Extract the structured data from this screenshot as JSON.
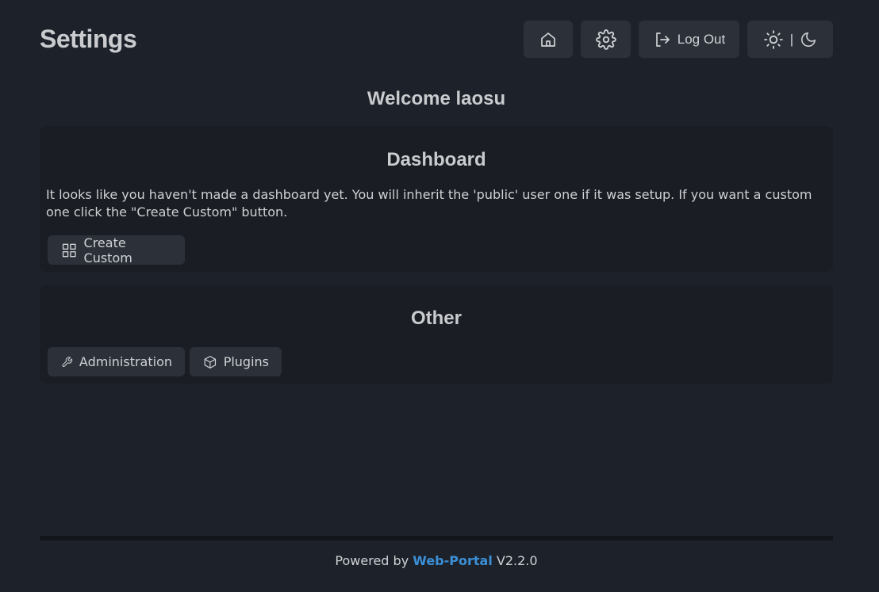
{
  "header": {
    "title": "Settings",
    "home_icon": "home-icon",
    "settings_icon": "gear-icon",
    "logout_label": "Log Out",
    "logout_icon": "log-out-icon",
    "theme_separator": "|",
    "theme_light_icon": "sun-icon",
    "theme_dark_icon": "moon-icon"
  },
  "welcome": "Welcome laosu",
  "dashboard": {
    "title": "Dashboard",
    "text": "It looks like you haven't made a dashboard yet. You will inherit the 'public' user one if it was setup. If you want a custom one click the \"Create Custom\" button.",
    "create_label": "Create Custom",
    "create_icon": "grid-icon"
  },
  "other": {
    "title": "Other",
    "admin_label": "Administration",
    "admin_icon": "wrench-icon",
    "plugins_label": "Plugins",
    "plugins_icon": "box-icon"
  },
  "footer": {
    "prefix": "Powered by",
    "link": "Web-Portal",
    "version": "V2.2.0"
  },
  "colors": {
    "background": "#1d222a",
    "card": "#1a1d23",
    "button": "#2c3139",
    "link": "#3b8fd6"
  }
}
